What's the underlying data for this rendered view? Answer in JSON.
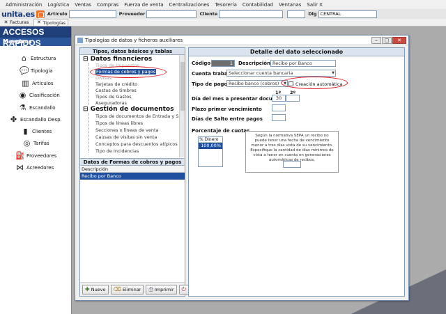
{
  "menu": [
    "Administración",
    "Logística",
    "Ventas",
    "Compras",
    "Fuerza de venta",
    "Centralizaciones",
    "Tesorería",
    "Contabilidad",
    "Ventanas",
    "Salir X"
  ],
  "toolbar": {
    "logo_text": "unita.es",
    "articulo_label": "Artículo",
    "proveedor_label": "Proveedor",
    "cliente_label": "Cliente",
    "dlg_label": "Dlg",
    "dlg_value": "CENTRAL"
  },
  "tabs": [
    {
      "label": "Facturas"
    },
    {
      "label": "Tipologías"
    }
  ],
  "sidebar": {
    "title": "ACCESOS RAPIDOS",
    "section": "Maestros",
    "items": [
      {
        "label": "Estructura",
        "icon": "house-icon"
      },
      {
        "label": "Tipología",
        "icon": "speech-bubble-icon"
      },
      {
        "label": "Artículos",
        "icon": "book-icon"
      },
      {
        "label": "Clasificación",
        "icon": "globe-icon"
      },
      {
        "label": "Escandallo",
        "icon": "flask-icon"
      },
      {
        "label": "Escandallo Desp.",
        "icon": "puzzle-icon"
      },
      {
        "label": "Clientes",
        "icon": "folder-icon"
      },
      {
        "label": "Tarifas",
        "icon": "coin-icon"
      },
      {
        "label": "Proveedores",
        "icon": "fuel-pump-icon"
      },
      {
        "label": "Acreedores",
        "icon": "bow-tie-icon"
      }
    ]
  },
  "window": {
    "title": "Tipologías de datos y ficheros auxiliares",
    "left_header": "Tipos, datos básicos y tablas auxiliares",
    "tree": {
      "group1": "Datos financieros",
      "group1_items": [
        "Tipos de impuestos",
        "Formas de cobros y pagos",
        "Divisas",
        "Tarjetas de crédito",
        "Costos de timbres",
        "Tipos de Gastos",
        "Aseguradoras"
      ],
      "group2": "Gestión de documentos",
      "group2_items": [
        "Tipos de documentos de Entrada y Salida",
        "Tipos de líneas libres",
        "Secciones o líneas de venta",
        "Causas de visitas sin venta",
        "Conceptos para descuentos atípicos",
        "Tipo de Incidencias"
      ]
    },
    "sub_title": "Datos de Formas de cobros y pagos",
    "grid_header": "Descripción",
    "grid_rows": [
      "Recibo por Banco"
    ],
    "buttons": {
      "nuevo": "Nuevo",
      "eliminar": "Eliminar",
      "imprimir": "Imprimir"
    },
    "right_header": "Detalle del dato seleccionado",
    "form": {
      "codigo_label": "Código",
      "codigo_value": "1",
      "descripcion_label": "Descripción",
      "descripcion_value": "Recibo por Banco",
      "cuenta_label": "Cuenta trabajo",
      "cuenta_value": "Seleccionar cuenta bancaria",
      "tipo_label": "Tipo de pago",
      "tipo_value": "Recibo banco (cobros)",
      "creacion_label": "Creación automática",
      "col1": "1º",
      "col2": "2º",
      "dia_label": "Día del mes a presentar documento",
      "dia_value": "30",
      "plazo_label": "Plazo primer vencimiento",
      "dias_label": "Días de Salto entre pagos",
      "porcentaje_label": "Porcentaje de cuotas",
      "pct_header": "% Dinero",
      "pct_value": "100,00%",
      "note": "Según la normativa SEPA un recibo no puede tener una fecha de vencimiento menor a tres días vista de su vencimiento. Especifique la cantidad de días mínimos de vista a tener en cuenta en generaciones automáticas de recibos."
    }
  }
}
